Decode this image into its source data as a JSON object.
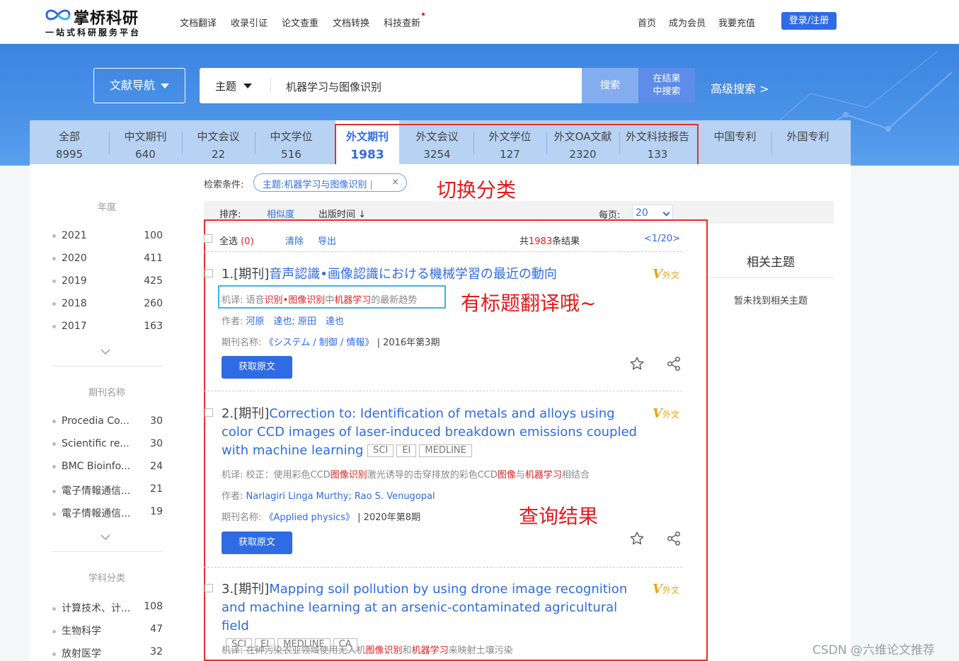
{
  "brand": {
    "name": "掌桥科研",
    "slogan": "一站式科研服务平台"
  },
  "topnav": [
    "文档翻译",
    "收录引证",
    "论文查重",
    "文档转换",
    "科技查新"
  ],
  "rightnav": [
    "首页",
    "成为会员",
    "我要充值"
  ],
  "login_label": "登录/注册",
  "search": {
    "nav_label": "文献导航",
    "field": "主题",
    "query": "机器学习与图像识别",
    "search_btn": "搜索",
    "in_result_line1": "在结果",
    "in_result_line2": "中搜索",
    "advanced": "高级搜索 >"
  },
  "tabs": [
    {
      "label": "全部",
      "count": "8995"
    },
    {
      "label": "中文期刊",
      "count": "640"
    },
    {
      "label": "中文会议",
      "count": "22"
    },
    {
      "label": "中文学位",
      "count": "516"
    },
    {
      "label": "外文期刊",
      "count": "1983"
    },
    {
      "label": "外文会议",
      "count": "3254"
    },
    {
      "label": "外文学位",
      "count": "127"
    },
    {
      "label": "外文OA文献",
      "count": "2320"
    },
    {
      "label": "外文科技报告",
      "count": "133"
    },
    {
      "label": "中国专利",
      "count": ""
    },
    {
      "label": "外国专利",
      "count": ""
    }
  ],
  "annotations": {
    "switch": "切换分类",
    "translate": "有标题翻译哦~",
    "results": "查询结果"
  },
  "sidebar": {
    "year_title": "年度",
    "years": [
      {
        "label": "2021",
        "count": "100"
      },
      {
        "label": "2020",
        "count": "411"
      },
      {
        "label": "2019",
        "count": "425"
      },
      {
        "label": "2018",
        "count": "260"
      },
      {
        "label": "2017",
        "count": "163"
      }
    ],
    "journal_title": "期刊名称",
    "journals": [
      {
        "label": "Procedia Co...",
        "count": "30"
      },
      {
        "label": "Scientific re...",
        "count": "30"
      },
      {
        "label": "BMC Bioinfo...",
        "count": "24"
      },
      {
        "label": "電子情報通信...",
        "count": "21"
      },
      {
        "label": "電子情報通信...",
        "count": "19"
      }
    ],
    "subject_title": "学科分类",
    "subjects": [
      {
        "label": "计算技术、计...",
        "count": "108"
      },
      {
        "label": "生物科学",
        "count": "47"
      },
      {
        "label": "放射医学",
        "count": "32"
      }
    ]
  },
  "conditions": {
    "label": "检索条件:",
    "tag": "主题:机器学习与图像识别",
    "sep": "|",
    "close": "×"
  },
  "sortbar": {
    "label": "排序:",
    "relevance": "相似度",
    "date": "出版时间",
    "date_arrow": "↓",
    "per_page_label": "每页:",
    "per_page": "20"
  },
  "listhead": {
    "select_all": "全选",
    "selected_count": "(0)",
    "clear": "清除",
    "export": "导出",
    "total_prefix": "共",
    "total": "1983",
    "total_suffix": "条结果",
    "pager": "<1/20>"
  },
  "results": [
    {
      "index": "1.[期刊]",
      "title": "音声認識•画像認識における機械学習の最近の動向",
      "badge_v": "V",
      "badge_text": "外文",
      "mt_label": "机译:",
      "mt_parts": [
        "语音",
        "识别",
        "•",
        "图像识别",
        "中",
        "机器学习",
        "的最新趋势"
      ],
      "authors_label": "作者:",
      "authors": "河原　達也;  原田　達也",
      "journal_label": "期刊名称:",
      "journal": "《システム / 制御 / 情報》",
      "issue": "| 2016年第3期",
      "button": "获取原文"
    },
    {
      "index": "2.[期刊]",
      "title": "Correction to: Identification of metals and alloys using color CCD images of laser-induced breakdown emissions coupled with machine learning",
      "tags": [
        "SCI",
        "EI",
        "MEDLINE"
      ],
      "badge_v": "V",
      "badge_text": "外文",
      "mt_label": "机译:",
      "mt_parts": [
        "校正：使用彩色CCD",
        "图像识别",
        "激光诱导的击穿排放的彩色CCD",
        "图像",
        "与",
        "机器学习",
        "相结合"
      ],
      "authors_label": "作者:",
      "authors": "Narlagiri Linga Murthy;  Rao S. Venugopal",
      "journal_label": "期刊名称:",
      "journal": "《Applied physics》",
      "issue": "| 2020年第8期",
      "button": "获取原文"
    },
    {
      "index": "3.[期刊]",
      "title": "Mapping soil pollution by using drone image recognition and machine learning at an arsenic-contaminated agricultural field",
      "tags": [
        "SCI",
        "EI",
        "MEDLINE",
        "CA"
      ],
      "badge_v": "V",
      "badge_text": "外文",
      "mt_label": "机译:",
      "mt_parts": [
        "在砷污染农业领域使用无人机",
        "图像识别",
        "和",
        "机器学习",
        "来映射土壤污染"
      ]
    }
  ],
  "related": {
    "title": "相关主题",
    "empty": "暂未找到相关主题"
  },
  "watermark": "CSDN @六维论文推荐",
  "colors": {
    "primary": "#2f6be3",
    "highlight": "#e02020",
    "annotation": "#e51a1a",
    "tab_bg": "#b7d2f3"
  }
}
